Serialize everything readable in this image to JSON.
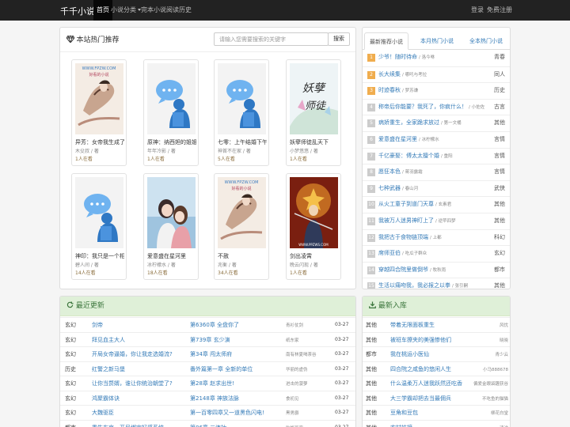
{
  "navbar": {
    "brand": "千千小说",
    "items": [
      "首页",
      "小说分类",
      "完本小说",
      "阅读历史"
    ],
    "login": "登录",
    "register": "免费注册"
  },
  "hot": {
    "title": "本站热门推荐",
    "search_placeholder": "请输入您需要搜索的关键字",
    "search_btn": "搜索",
    "books": [
      {
        "name": "异芳：女帝我生成了抖",
        "author": "木殳叔 / 著",
        "readers": "1人在看",
        "cover": "ink"
      },
      {
        "name": "原神：纳西妲的姐姐我",
        "author": "年年冷影 / 著",
        "readers": "1人在看",
        "cover": "avatar"
      },
      {
        "name": "七零：上午结婚下午相",
        "author": "神首不在家 / 著",
        "readers": "5人在看",
        "cover": "avatar"
      },
      {
        "name": "妖孽师徒乱天下",
        "author": "小梦悠悠 / 著",
        "readers": "1人在看",
        "cover": "yao"
      },
      {
        "name": "神印：我只是一个相信",
        "author": "碧人间 / 著",
        "readers": "14人在看",
        "cover": "avatar"
      },
      {
        "name": "爱意盛在星河里",
        "author": "冰柠檬水 / 著",
        "readers": "18人在看",
        "cover": "couple"
      },
      {
        "name": "不赦",
        "author": "兆衡 / 著",
        "readers": "34人在看",
        "cover": "ink"
      },
      {
        "name": "剑出凌霄",
        "author": "晚云闪现 / 著",
        "readers": "1人在看",
        "cover": "sword"
      }
    ],
    "cover_watermark": "WWW.FPZW.COM",
    "cover_sub": "好看的小说",
    "yao_text": "妖孽师徒",
    "sword_text": "WWW.PPZWS.COM"
  },
  "rank": {
    "tabs": [
      "最新推荐小说",
      "本月热门小说",
      "全本热门小说"
    ],
    "items": [
      {
        "n": "1",
        "title": "少爷！随时待命",
        "author": "洛今咻",
        "cat": "青春"
      },
      {
        "n": "2",
        "title": "长大续集",
        "author": "哪吒与考拉",
        "cat": "同人"
      },
      {
        "n": "3",
        "title": "时迹春秋",
        "author": "梦苏谦",
        "cat": "历史"
      },
      {
        "n": "4",
        "title": "称帝后你能要？我死了，你疯什么！",
        "author": "小佐佐",
        "cat": "古言"
      },
      {
        "n": "5",
        "title": "病娇重生，全家跪求放过",
        "author": "第一文桶",
        "cat": "其他"
      },
      {
        "n": "6",
        "title": "爱意盛在星河里",
        "author": "冰柠檬水",
        "cat": "言情"
      },
      {
        "n": "7",
        "title": "千亿豪娶：傅太太擅个婚",
        "author": "重阳",
        "cat": "言情"
      },
      {
        "n": "8",
        "title": "愿狂本色",
        "author": "蒋羽露霜",
        "cat": "言情"
      },
      {
        "n": "9",
        "title": "七种武器",
        "author": "春山河",
        "cat": "武侠"
      },
      {
        "n": "10",
        "title": "从火工童子到道门天尊",
        "author": "玄素君",
        "cat": "其他"
      },
      {
        "n": "11",
        "title": "我被万人迷男神盯上了",
        "author": "逆苹四梦",
        "cat": "其他"
      },
      {
        "n": "12",
        "title": "我把古于食物链顶端",
        "author": "上都",
        "cat": "科幻"
      },
      {
        "n": "13",
        "title": "席师亚伯",
        "author": "吃瓜子群众",
        "cat": "玄幻"
      },
      {
        "n": "14",
        "title": "穿越四合院里做倒爷",
        "author": "牧秋雨",
        "cat": "都市"
      },
      {
        "n": "15",
        "title": "生活以痛吻我，我必报之以拳",
        "author": "张引嗣",
        "cat": "其他"
      }
    ]
  },
  "latest": {
    "title": "最近更新",
    "rows": [
      {
        "cat": "玄幻",
        "book": "剑帝",
        "chapter": "第6360章 全盘你了",
        "author": "青衫仗剑",
        "date": "03-27"
      },
      {
        "cat": "玄幻",
        "book": "拜见血主大人",
        "chapter": "第739章 玄少演",
        "author": "纸东家",
        "date": "03-27"
      },
      {
        "cat": "玄幻",
        "book": "开局女帝逼婚，你让我走选婚流?",
        "chapter": "第34章 闯太师府",
        "author": "南有林夏喝茶谷",
        "date": "03-27"
      },
      {
        "cat": "历史",
        "book": "红警之新马堡",
        "chapter": "番外篇第一章 全新的单位",
        "author": "华丽的虚伪",
        "date": "03-27"
      },
      {
        "cat": "玄幻",
        "book": "让你当赘婿，谁让你统治朝堂了?",
        "chapter": "第28章 赵求出世!",
        "author": "进击的菠萝",
        "date": "03-27"
      },
      {
        "cat": "玄幻",
        "book": "鸿聚霸体诀",
        "chapter": "第2148章 神族法脉",
        "author": "食初见",
        "date": "03-27"
      },
      {
        "cat": "玄幻",
        "book": "大魏驱臣",
        "chapter": "第一百零四章又一道黑色闪电!",
        "author": "黑男爵",
        "date": "03-27"
      },
      {
        "cat": "都市",
        "book": "重生东京，开局绑定好感系统",
        "chapter": "第86章 三连抽",
        "author": "吃饭写字",
        "date": "03-27"
      }
    ]
  },
  "newbook": {
    "title": "最新入库",
    "rows": [
      {
        "cat": "其他",
        "book": "带着无限面板重生",
        "author": "风忧"
      },
      {
        "cat": "其他",
        "book": "被班车撩夹的美强惨他们",
        "author": "晓晓"
      },
      {
        "cat": "都市",
        "book": "我在桃运小医仙",
        "author": "青少云"
      },
      {
        "cat": "其他",
        "book": "四合院之咸鱼的悠闲人生",
        "author": "小马888678"
      },
      {
        "cat": "其他",
        "book": "什么温柔万人迷我跃然还吃香",
        "author": "偏爱金眼袋趣获谷"
      },
      {
        "cat": "其他",
        "book": "大三学霸却把去当最佣兵",
        "author": "不吃鱼的猫猫"
      },
      {
        "cat": "其他",
        "book": "豆角和豆包",
        "author": "柳花白堂"
      },
      {
        "cat": "其他",
        "book": "农村妹接",
        "author": "鸿途"
      }
    ]
  }
}
